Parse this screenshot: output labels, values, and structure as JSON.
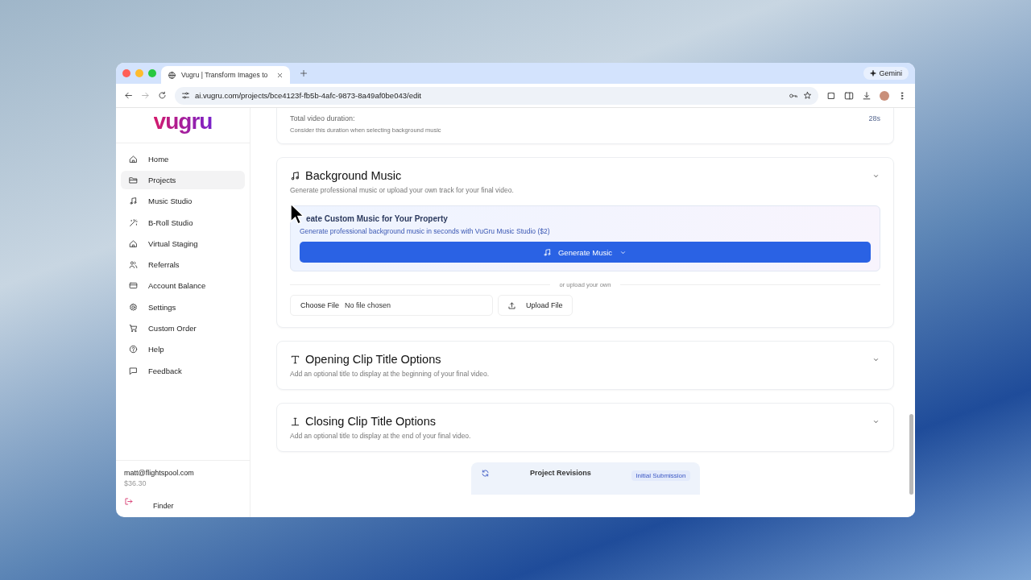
{
  "browser": {
    "tab_title": "Vugru | Transform Images to",
    "url": "ai.vugru.com/projects/bce4123f-fb5b-4afc-9873-8a49af0be043/edit",
    "gemini": "Gemini"
  },
  "sidebar": {
    "logo": "vugru",
    "items": [
      {
        "label": "Home",
        "selected": false
      },
      {
        "label": "Projects",
        "selected": true
      },
      {
        "label": "Music Studio",
        "selected": false
      },
      {
        "label": "B-Roll Studio",
        "selected": false
      },
      {
        "label": "Virtual Staging",
        "selected": false
      },
      {
        "label": "Referrals",
        "selected": false
      },
      {
        "label": "Account Balance",
        "selected": false
      },
      {
        "label": "Settings",
        "selected": false
      },
      {
        "label": "Custom Order",
        "selected": false
      },
      {
        "label": "Help",
        "selected": false
      },
      {
        "label": "Feedback",
        "selected": false
      }
    ],
    "email": "matt@flightspool.com",
    "balance": "$36.30",
    "dock_tooltip": "Finder"
  },
  "duration": {
    "label": "Total video duration:",
    "hint": "Consider this duration when selecting background music",
    "value": "28s"
  },
  "sections": [
    {
      "kind": "music",
      "title": "Background Music",
      "description": "Generate professional music or upload your own track for your final video.",
      "promo_title": "eate Custom Music for Your Property",
      "promo_text": "Generate professional background music in seconds with VuGru Music Studio ($2)",
      "generate_button": "Generate Music",
      "divider": "or upload your own",
      "choose_file": "Choose File",
      "no_file": "No file chosen",
      "upload_button": "Upload File"
    },
    {
      "kind": "opening",
      "title": "Opening Clip Title Options",
      "description": "Add an optional title to display at the beginning of your final video."
    },
    {
      "kind": "closing",
      "title": "Closing Clip Title Options",
      "description": "Add an optional title to display at the end of your final video."
    }
  ],
  "revisions": {
    "title": "Project Revisions",
    "badge": "Initial Submission"
  }
}
